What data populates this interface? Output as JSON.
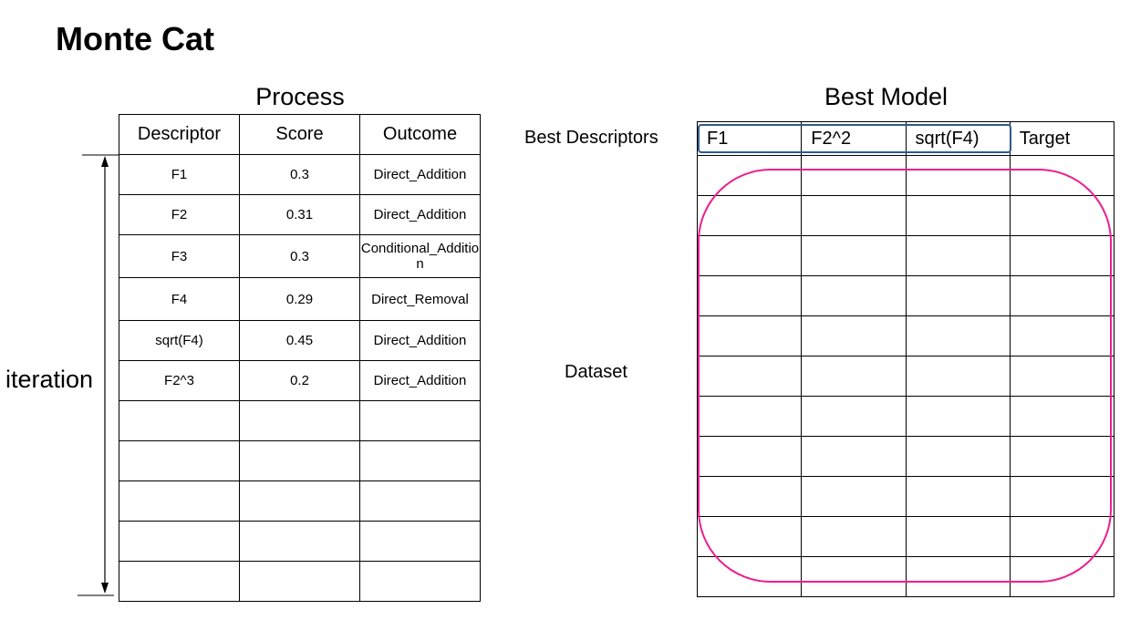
{
  "title": "Monte Cat",
  "process": {
    "title": "Process",
    "headers": [
      "Descriptor",
      "Score",
      "Outcome"
    ],
    "rows": [
      [
        "F1",
        "0.3",
        "Direct_Addition"
      ],
      [
        "F2",
        "0.31",
        "Direct_Addition"
      ],
      [
        "F3",
        "0.3",
        "Conditional_Addition"
      ],
      [
        "F4",
        "0.29",
        "Direct_Removal"
      ],
      [
        "sqrt(F4)",
        "0.45",
        "Direct_Addition"
      ],
      [
        "F2^3",
        "0.2",
        "Direct_Addition"
      ],
      [
        "",
        "",
        ""
      ],
      [
        "",
        "",
        ""
      ],
      [
        "",
        "",
        ""
      ],
      [
        "",
        "",
        ""
      ],
      [
        "",
        "",
        ""
      ]
    ],
    "iteration_label": "iteration"
  },
  "best_model": {
    "title": "Best Model",
    "best_descriptors_label": "Best Descriptors",
    "dataset_label": "Dataset",
    "headers": [
      "F1",
      "F2^2",
      "sqrt(F4)",
      "Target"
    ],
    "empty_row_count": 11
  },
  "colors": {
    "descriptor_highlight": "#2e5b8f",
    "dataset_highlight": "#ec1f8f"
  }
}
